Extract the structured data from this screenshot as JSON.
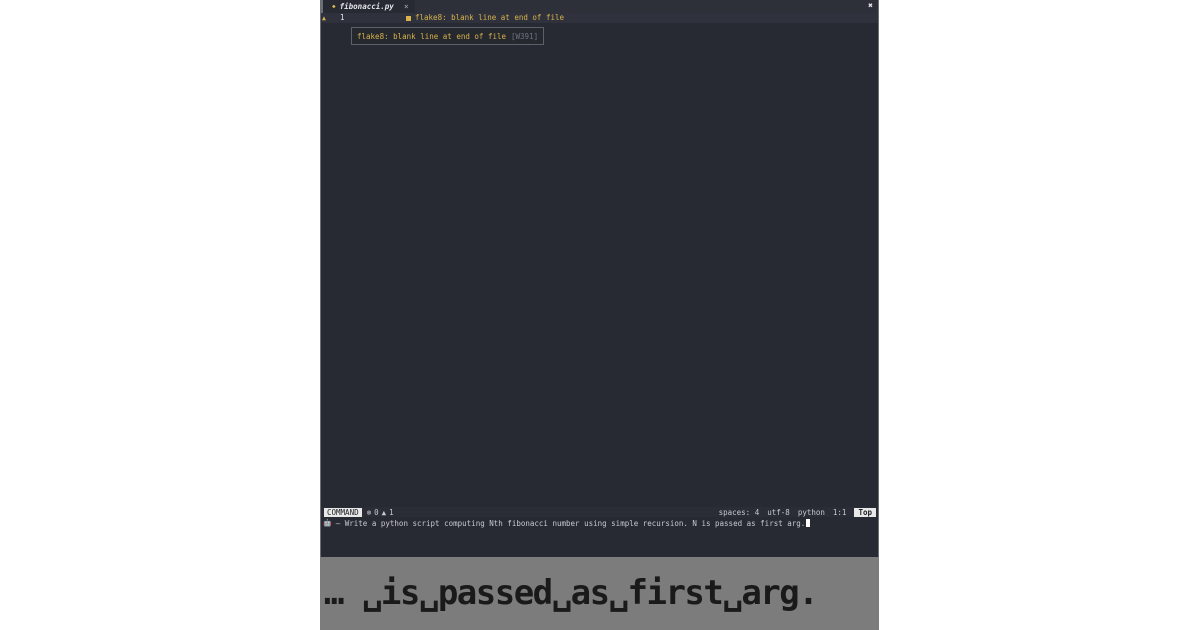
{
  "editor": {
    "tab": {
      "modified_indicator": "◆",
      "title": "fibonacci.py",
      "close_glyph": "×"
    },
    "window_close_glyph": "✖",
    "lines": [
      {
        "number": "1",
        "warning_glyph": "▲"
      }
    ],
    "inline_diagnostic": {
      "message": "flake8: blank line at end of file"
    },
    "tooltip": {
      "message": "flake8: blank line at end of file",
      "code": "[W391]"
    }
  },
  "status_line": {
    "mode": "COMMAND",
    "error_glyph": "⊗",
    "error_count": "0",
    "warning_glyph": "▲",
    "warning_count": "1",
    "indent": "spaces: 4",
    "encoding": "utf-8",
    "filetype": "python",
    "position": "1:1",
    "scroll": "Top"
  },
  "prompt": {
    "icon": "🤖",
    "text": "– Write a python script computing Nth fibonacci number using simple recursion. N is passed as first arg."
  },
  "keystroke_overlay": {
    "text": "… ␣is␣passed␣as␣first␣arg."
  },
  "colors": {
    "background": "#282a33",
    "warning": "#d8b24a",
    "badge": "#e8e8e8",
    "overlay": "#7c7c7c"
  }
}
